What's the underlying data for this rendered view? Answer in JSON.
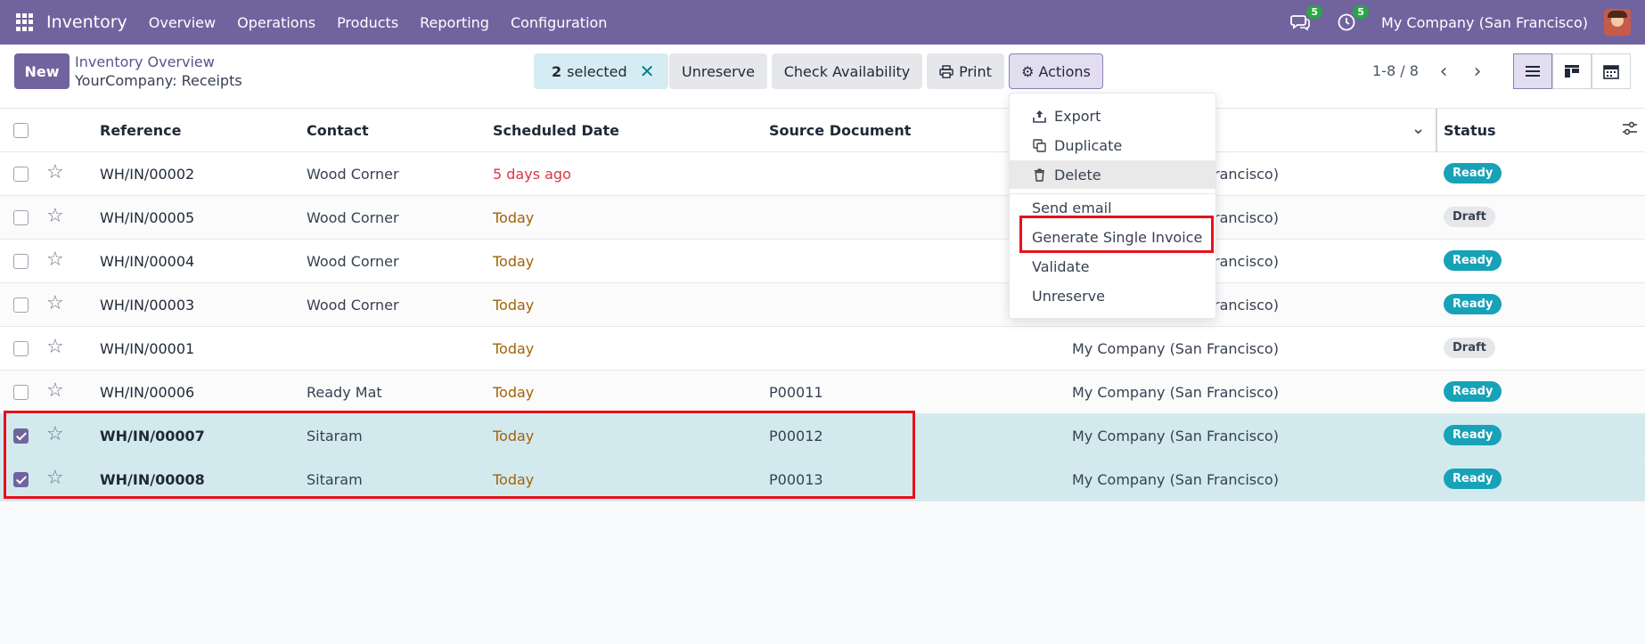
{
  "navbar": {
    "brand": "Inventory",
    "menus": [
      "Overview",
      "Operations",
      "Products",
      "Reporting",
      "Configuration"
    ],
    "messages_count": "5",
    "activities_count": "5",
    "company": "My Company (San Francisco)"
  },
  "control": {
    "new_label": "New",
    "breadcrumb_parent": "Inventory Overview",
    "breadcrumb_current": "YourCompany: Receipts",
    "selected_count": "2",
    "selected_label": "selected",
    "unreserve_label": "Unreserve",
    "check_availability_label": "Check Availability",
    "print_label": "Print",
    "actions_label": "Actions",
    "pager": "1-8 / 8"
  },
  "table": {
    "headers": {
      "reference": "Reference",
      "contact": "Contact",
      "scheduled_date": "Scheduled Date",
      "source_document": "Source Document",
      "status": "Status"
    },
    "rows": [
      {
        "reference": "WH/IN/00002",
        "contact": "Wood Corner",
        "date": "5 days ago",
        "source": "",
        "company": "My Company (San Francisco)",
        "status": "Ready"
      },
      {
        "reference": "WH/IN/00005",
        "contact": "Wood Corner",
        "date": "Today",
        "source": "",
        "company": "My Company (San Francisco)",
        "status": "Draft"
      },
      {
        "reference": "WH/IN/00004",
        "contact": "Wood Corner",
        "date": "Today",
        "source": "",
        "company": "My Company (San Francisco)",
        "status": "Ready"
      },
      {
        "reference": "WH/IN/00003",
        "contact": "Wood Corner",
        "date": "Today",
        "source": "",
        "company": "My Company (San Francisco)",
        "status": "Ready"
      },
      {
        "reference": "WH/IN/00001",
        "contact": "",
        "date": "Today",
        "source": "",
        "company": "My Company (San Francisco)",
        "status": "Draft"
      },
      {
        "reference": "WH/IN/00006",
        "contact": "Ready Mat",
        "date": "Today",
        "source": "P00011",
        "company": "My Company (San Francisco)",
        "status": "Ready"
      },
      {
        "reference": "WH/IN/00007",
        "contact": "Sitaram",
        "date": "Today",
        "source": "P00012",
        "company": "My Company (San Francisco)",
        "status": "Ready"
      },
      {
        "reference": "WH/IN/00008",
        "contact": "Sitaram",
        "date": "Today",
        "source": "P00013",
        "company": "My Company (San Francisco)",
        "status": "Ready"
      }
    ]
  },
  "actions_menu": {
    "export": "Export",
    "duplicate": "Duplicate",
    "delete": "Delete",
    "send_email": "Send email",
    "generate_single_invoice": "Generate Single Invoice",
    "validate": "Validate",
    "unreserve": "Unreserve"
  },
  "colors": {
    "brand": "#71639e",
    "selected_row": "#d2eaee",
    "ready": "#17a2b8",
    "late": "#dc3545",
    "today": "#a16207",
    "highlight": "#e8101c"
  }
}
